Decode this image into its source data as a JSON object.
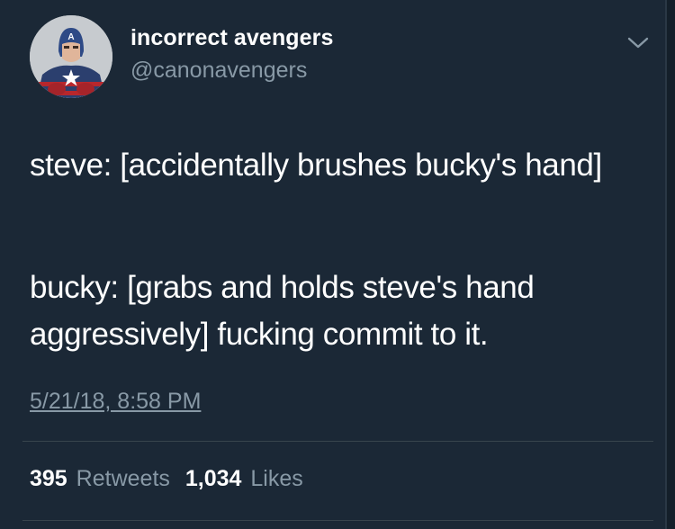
{
  "user": {
    "display_name": "incorrect avengers",
    "handle": "@canonavengers"
  },
  "tweet": {
    "paragraphs": [
      "steve: [accidentally brushes bucky's hand]",
      "bucky: [grabs and holds steve's hand aggressively] fucking commit to it."
    ],
    "timestamp": "5/21/18, 8:58 PM"
  },
  "stats": {
    "retweets_count": "395",
    "retweets_label": "Retweets",
    "likes_count": "1,034",
    "likes_label": "Likes"
  },
  "icons": {
    "menu": "chevron-down-icon",
    "avatar": "captain-america-avatar"
  },
  "colors": {
    "background": "#1b2836",
    "text": "#ffffff",
    "secondary_text": "#8899a6",
    "divider": "#38444d"
  }
}
